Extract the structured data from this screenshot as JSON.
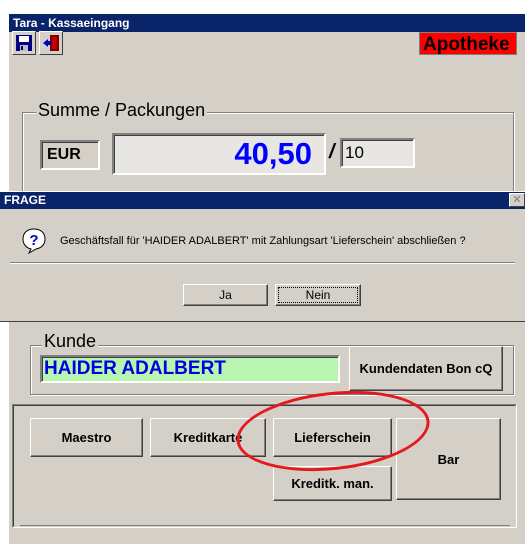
{
  "window": {
    "title": "Tara - Kassaeingang"
  },
  "toolbar": {
    "save_icon": "floppy-disk-icon",
    "exit_icon": "exit-door-icon"
  },
  "badge": {
    "text": "Apotheke",
    "color": "#ff0000"
  },
  "summary": {
    "group_label": "Summe / Packungen",
    "currency": "EUR",
    "amount": "40,50",
    "separator": "/",
    "packages": "10",
    "amount_color": "#0000ff"
  },
  "dialog": {
    "title": "FRAGE",
    "close_label": "✕",
    "icon": "question-icon",
    "message": "Geschäftsfall für 'HAIDER ADALBERT' mit Zahlungsart 'Lieferschein' abschließen ?",
    "yes_label": "Ja",
    "no_label": "Nein"
  },
  "customer": {
    "group_label": "Kunde",
    "name": "HAIDER ADALBERT",
    "name_bg": "#b8f5b0",
    "data_button": "Kundendaten Bon cQ"
  },
  "payment": {
    "maestro": "Maestro",
    "kreditkarte": "Kreditkarte",
    "lieferschein": "Lieferschein",
    "bar": "Bar",
    "kreditk_man": "Kreditk. man."
  },
  "annotation": {
    "highlight_color": "#e3191e"
  }
}
